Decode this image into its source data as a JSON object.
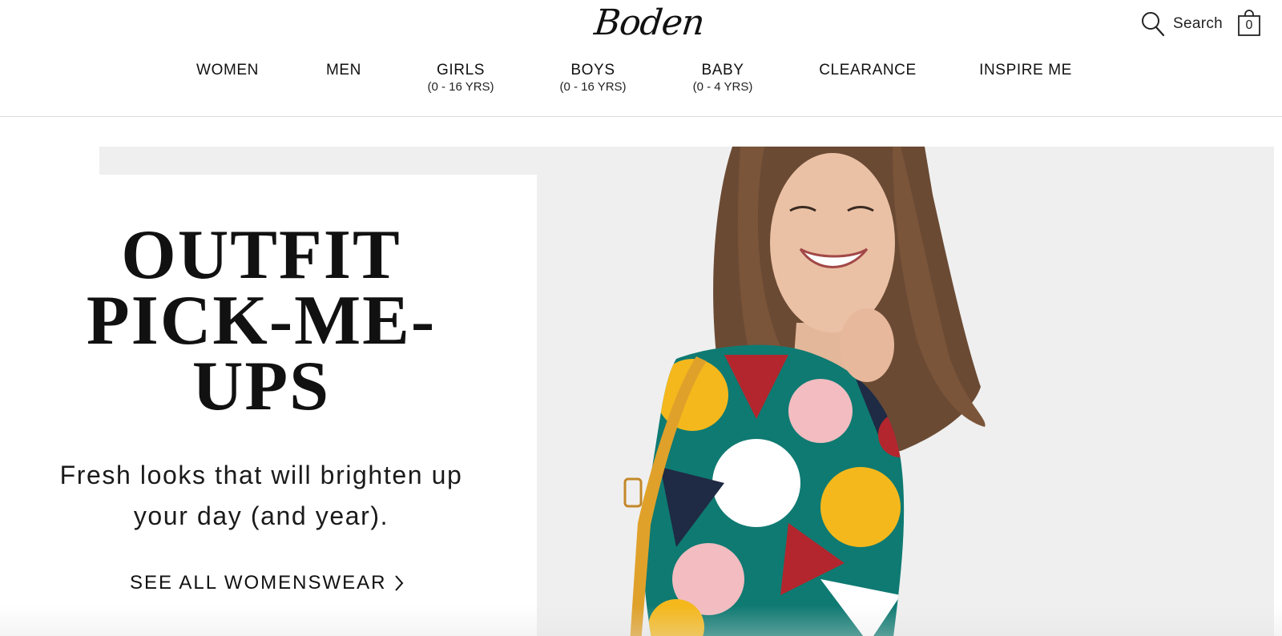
{
  "brand": {
    "logo_text": "Boden"
  },
  "header": {
    "search_label": "Search",
    "bag_count": "0"
  },
  "nav": {
    "items": [
      {
        "label": "WOMEN",
        "sub": ""
      },
      {
        "label": "MEN",
        "sub": ""
      },
      {
        "label": "GIRLS",
        "sub": "(0 - 16 YRS)"
      },
      {
        "label": "BOYS",
        "sub": "(0 - 16 YRS)"
      },
      {
        "label": "BABY",
        "sub": "(0 - 4 YRS)"
      },
      {
        "label": "CLEARANCE",
        "sub": ""
      },
      {
        "label": "INSPIRE ME",
        "sub": ""
      }
    ]
  },
  "hero": {
    "headline": "OUTFIT\nPICK-ME-\nUPS",
    "subtext": "Fresh looks that will brighten up your day (and year).",
    "cta_label": "SEE ALL WOMENSWEAR"
  },
  "icons": {
    "search": "search-icon",
    "bag": "shopping-bag-icon",
    "cta_arrow": "chevron-right-icon"
  },
  "colors": {
    "hero_background": "#efefef",
    "text": "#111111",
    "bag_strap": "#e0a12a",
    "print_teal": "#0f7a72",
    "print_yellow": "#f5b81c",
    "print_red": "#b3262d",
    "print_pink": "#f2bcc0",
    "print_navy": "#1f2a44"
  }
}
